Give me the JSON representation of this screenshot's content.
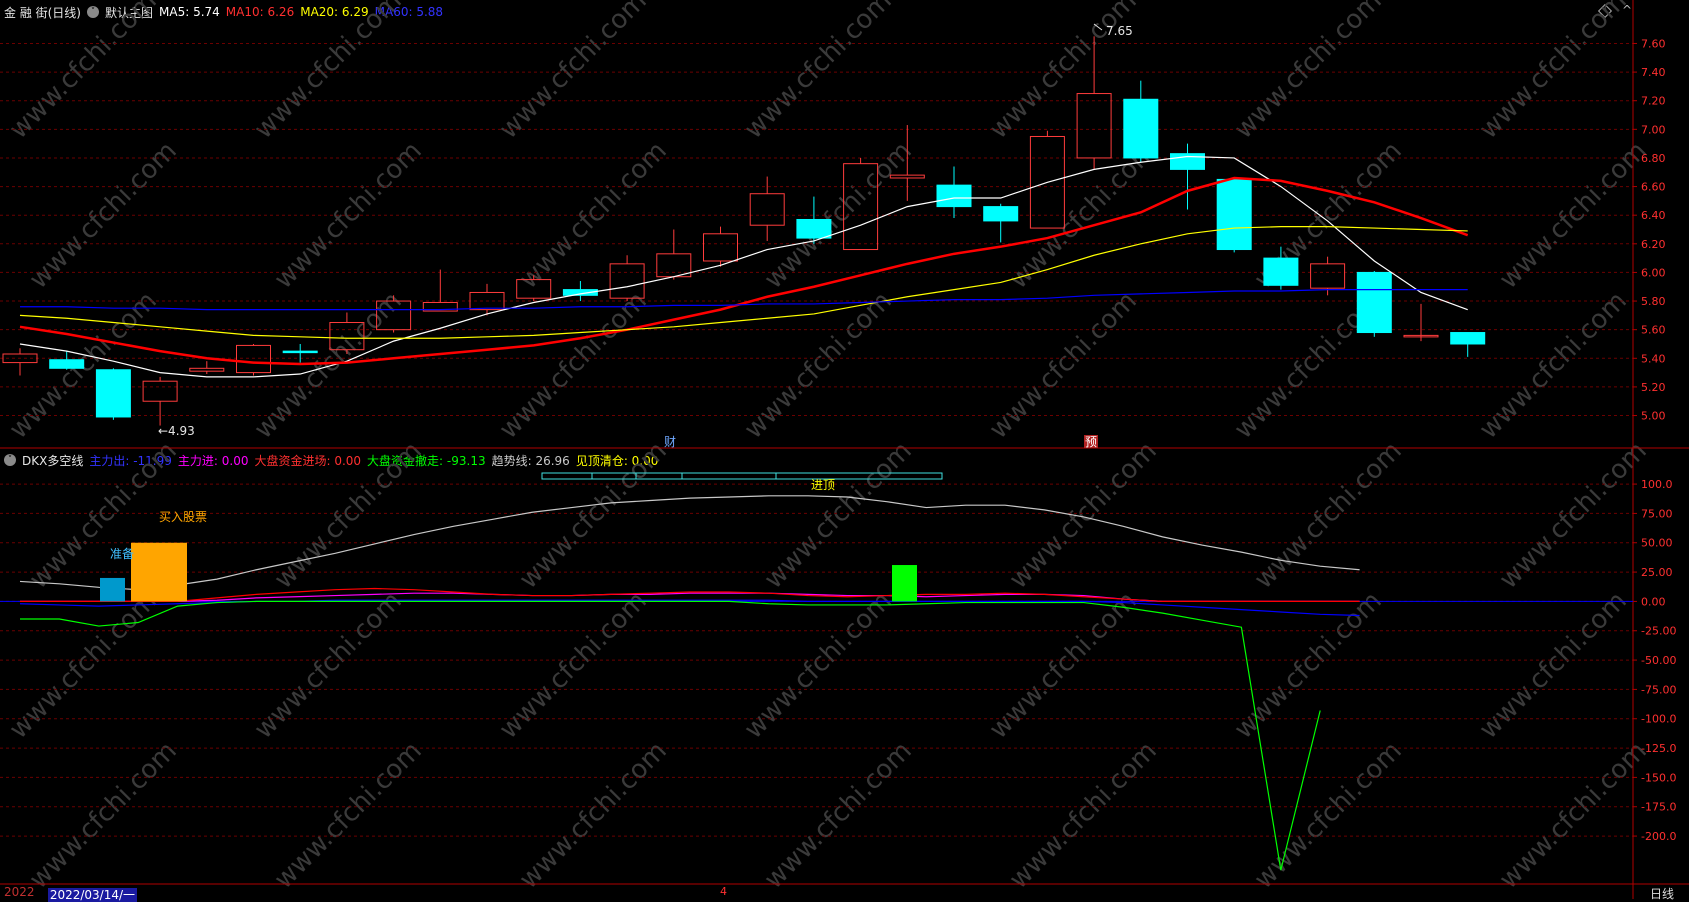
{
  "main_header": {
    "stock_name": "金 融 街(日线)",
    "chart_name": "默认主图",
    "ma5_label": "MA5: 5.74",
    "ma10_label": "MA10: 6.26",
    "ma20_label": "MA20: 6.29",
    "ma60_label": "MA60: 5.88"
  },
  "indicator_header": {
    "name": "DKX多空线",
    "zhuli_chu": "主力出: -11.99",
    "zhuli_jin": "主力进: 0.00",
    "dapan_jin": "大盘资金进场: 0.00",
    "dapan_che": "大盘资金撤走: -93.13",
    "trend_line": "趋势线: 26.96",
    "top_clear": "见顶清仓: 0.00"
  },
  "annotations": {
    "high_price": "7.65",
    "low_price": "←4.93",
    "cai_marker": "财",
    "yu_marker": "预",
    "buy_label": "买入股票",
    "prepare_label": "准备",
    "top_label": "进顶"
  },
  "status_bar": {
    "year_fragment": "2022",
    "date_label": "2022/03/14/一",
    "month_marker": "4",
    "period_label": "日线"
  },
  "watermark": "www.cfchi.com",
  "colors": {
    "background": "#000000",
    "grid": "#6b0000",
    "axis_line": "#b00000",
    "up_candle": "#ff3c3c",
    "down_candle": "#00ffff",
    "ma5": "#ffffff",
    "ma10": "#ff0000",
    "ma20": "#ffff00",
    "ma60": "#0000ff",
    "trend": "#c8c8c8",
    "zhuli_chu": "#0000ff",
    "zhuli_jin": "#ff00ff",
    "dapan_jin": "#ff0000",
    "dapan_che": "#00ff00",
    "top_clear": "#ffff00",
    "buy_bar": "#ffa500",
    "prepare_bar": "#0099cc",
    "green_bar": "#00ff00"
  },
  "chart_data": [
    {
      "type": "candlestick",
      "title": "金 融 街(日线)",
      "ylim": [
        4.85,
        7.75
      ],
      "yticks": [
        5.0,
        5.2,
        5.4,
        5.6,
        5.8,
        6.0,
        6.2,
        6.4,
        6.6,
        6.8,
        7.0,
        7.2,
        7.4,
        7.6
      ],
      "ytick_labels": [
        "5.00",
        "5.20",
        "5.40",
        "5.60",
        "5.80",
        "6.00",
        "6.20",
        "6.40",
        "6.60",
        "6.80",
        "7.00",
        "7.20",
        "7.40",
        "7.60"
      ],
      "grid": true,
      "candles": [
        {
          "o": 5.37,
          "h": 5.47,
          "l": 5.28,
          "c": 5.43
        },
        {
          "o": 5.39,
          "h": 5.45,
          "l": 5.32,
          "c": 5.33
        },
        {
          "o": 5.32,
          "h": 5.33,
          "l": 4.97,
          "c": 4.99
        },
        {
          "o": 5.1,
          "h": 5.27,
          "l": 4.93,
          "c": 5.24
        },
        {
          "o": 5.31,
          "h": 5.38,
          "l": 5.29,
          "c": 5.33
        },
        {
          "o": 5.3,
          "h": 5.5,
          "l": 5.28,
          "c": 5.49
        },
        {
          "o": 5.45,
          "h": 5.5,
          "l": 5.37,
          "c": 5.44
        },
        {
          "o": 5.46,
          "h": 5.72,
          "l": 5.43,
          "c": 5.65
        },
        {
          "o": 5.6,
          "h": 5.84,
          "l": 5.58,
          "c": 5.8
        },
        {
          "o": 5.73,
          "h": 6.02,
          "l": 5.73,
          "c": 5.79
        },
        {
          "o": 5.74,
          "h": 5.92,
          "l": 5.7,
          "c": 5.86
        },
        {
          "o": 5.82,
          "h": 5.98,
          "l": 5.8,
          "c": 5.95
        },
        {
          "o": 5.88,
          "h": 5.94,
          "l": 5.8,
          "c": 5.84
        },
        {
          "o": 5.82,
          "h": 6.12,
          "l": 5.8,
          "c": 6.06
        },
        {
          "o": 5.97,
          "h": 6.3,
          "l": 5.95,
          "c": 6.13
        },
        {
          "o": 6.08,
          "h": 6.32,
          "l": 6.04,
          "c": 6.27
        },
        {
          "o": 6.33,
          "h": 6.67,
          "l": 6.22,
          "c": 6.55
        },
        {
          "o": 6.37,
          "h": 6.53,
          "l": 6.2,
          "c": 6.24
        },
        {
          "o": 6.16,
          "h": 6.8,
          "l": 6.16,
          "c": 6.76
        },
        {
          "o": 6.66,
          "h": 7.03,
          "l": 6.5,
          "c": 6.68
        },
        {
          "o": 6.61,
          "h": 6.74,
          "l": 6.38,
          "c": 6.46
        },
        {
          "o": 6.46,
          "h": 6.48,
          "l": 6.21,
          "c": 6.36
        },
        {
          "o": 6.31,
          "h": 6.99,
          "l": 6.31,
          "c": 6.95
        },
        {
          "o": 6.8,
          "h": 7.65,
          "l": 6.72,
          "c": 7.25
        },
        {
          "o": 7.21,
          "h": 7.34,
          "l": 6.77,
          "c": 6.8
        },
        {
          "o": 6.83,
          "h": 6.9,
          "l": 6.44,
          "c": 6.72
        },
        {
          "o": 6.65,
          "h": 6.66,
          "l": 6.14,
          "c": 6.16
        },
        {
          "o": 6.1,
          "h": 6.18,
          "l": 5.88,
          "c": 5.91
        },
        {
          "o": 5.89,
          "h": 6.11,
          "l": 5.84,
          "c": 6.06
        },
        {
          "o": 6.0,
          "h": 6.01,
          "l": 5.55,
          "c": 5.58
        },
        {
          "o": 5.56,
          "h": 5.78,
          "l": 5.52,
          "c": 5.56
        },
        {
          "o": 5.58,
          "h": 5.58,
          "l": 5.41,
          "c": 5.5
        }
      ],
      "series": [
        {
          "name": "MA5",
          "values": [
            5.5,
            5.45,
            5.38,
            5.3,
            5.27,
            5.27,
            5.29,
            5.38,
            5.52,
            5.61,
            5.71,
            5.79,
            5.85,
            5.9,
            5.97,
            6.05,
            6.16,
            6.22,
            6.33,
            6.46,
            6.52,
            6.52,
            6.63,
            6.72,
            6.77,
            6.81,
            6.8,
            6.6,
            6.36,
            6.08,
            5.86,
            5.74
          ]
        },
        {
          "name": "MA10",
          "values": [
            5.62,
            5.57,
            5.51,
            5.45,
            5.4,
            5.37,
            5.36,
            5.37,
            5.4,
            5.43,
            5.46,
            5.49,
            5.54,
            5.6,
            5.67,
            5.74,
            5.83,
            5.9,
            5.98,
            6.06,
            6.13,
            6.18,
            6.24,
            6.33,
            6.42,
            6.57,
            6.66,
            6.64,
            6.57,
            6.49,
            6.38,
            6.26
          ]
        },
        {
          "name": "MA20",
          "values": [
            5.7,
            5.68,
            5.65,
            5.62,
            5.59,
            5.56,
            5.55,
            5.54,
            5.54,
            5.54,
            5.55,
            5.56,
            5.58,
            5.6,
            5.62,
            5.65,
            5.68,
            5.71,
            5.77,
            5.83,
            5.88,
            5.93,
            6.02,
            6.12,
            6.2,
            6.27,
            6.31,
            6.32,
            6.32,
            6.31,
            6.3,
            6.29
          ]
        },
        {
          "name": "MA60",
          "values": [
            5.76,
            5.76,
            5.75,
            5.75,
            5.74,
            5.74,
            5.74,
            5.74,
            5.74,
            5.74,
            5.75,
            5.75,
            5.76,
            5.76,
            5.77,
            5.77,
            5.78,
            5.78,
            5.79,
            5.8,
            5.81,
            5.81,
            5.82,
            5.84,
            5.85,
            5.86,
            5.87,
            5.87,
            5.88,
            5.88,
            5.88,
            5.88
          ]
        }
      ]
    },
    {
      "type": "line",
      "title": "DKX多空线",
      "ylim": [
        -240,
        112
      ],
      "yticks": [
        100,
        75,
        50,
        25,
        0,
        -25,
        -50,
        -75,
        -100,
        -125,
        -150,
        -175,
        -200
      ],
      "ytick_labels": [
        "100.0",
        "75.00",
        "50.00",
        "25.00",
        "0.00",
        "-25.00",
        "-50.00",
        "-75.00",
        "-100.0",
        "-125.0",
        "-150.0",
        "-175.0",
        "-200.0"
      ],
      "grid": true,
      "series": [
        {
          "name": "趋势线",
          "values": [
            17,
            15,
            12,
            10,
            14,
            19,
            27,
            34,
            41,
            49,
            57,
            64,
            70,
            76,
            80,
            84,
            86,
            88,
            89,
            90,
            90,
            89,
            85,
            80,
            82,
            82,
            78,
            72,
            64,
            55,
            48,
            42,
            35,
            30,
            27
          ]
        },
        {
          "name": "主力出",
          "values": [
            -2,
            -3,
            -4,
            -3,
            -2,
            -1,
            0,
            0,
            1,
            1,
            1,
            1,
            1,
            1,
            1,
            1,
            1,
            1,
            1,
            1,
            0,
            0,
            0,
            0,
            0,
            0,
            0,
            0,
            -1,
            -3,
            -5,
            -7,
            -9,
            -11,
            -12
          ]
        },
        {
          "name": "主力进",
          "values": [
            0,
            0,
            0,
            0,
            0,
            1,
            3,
            4,
            5,
            6,
            7,
            7,
            6,
            5,
            5,
            6,
            6,
            7,
            7,
            7,
            6,
            5,
            5,
            4,
            5,
            6,
            6,
            5,
            2,
            0,
            0,
            0,
            0,
            0,
            0
          ]
        },
        {
          "name": "大盘资金进场",
          "values": [
            0,
            0,
            0,
            0,
            0,
            3,
            6,
            8,
            10,
            11,
            10,
            8,
            6,
            5,
            5,
            6,
            7,
            8,
            8,
            7,
            5,
            4,
            5,
            6,
            6,
            7,
            6,
            4,
            2,
            0,
            0,
            0,
            0,
            0,
            0
          ]
        },
        {
          "name": "大盘资金撤走",
          "values": [
            -15,
            -15,
            -21,
            -18,
            -4,
            -1,
            0,
            0,
            0,
            0,
            0,
            0,
            0,
            0,
            0,
            0,
            0,
            0,
            0,
            -2,
            -3,
            -3,
            -3,
            -2,
            -1,
            -1,
            -1,
            -1,
            -5,
            -10,
            -16,
            -22,
            -229,
            -93
          ]
        }
      ],
      "bars": [
        {
          "name": "准备",
          "value": 20
        },
        {
          "name": "买入股票",
          "value": 50
        },
        {
          "name": "green",
          "value": 31
        }
      ]
    }
  ]
}
